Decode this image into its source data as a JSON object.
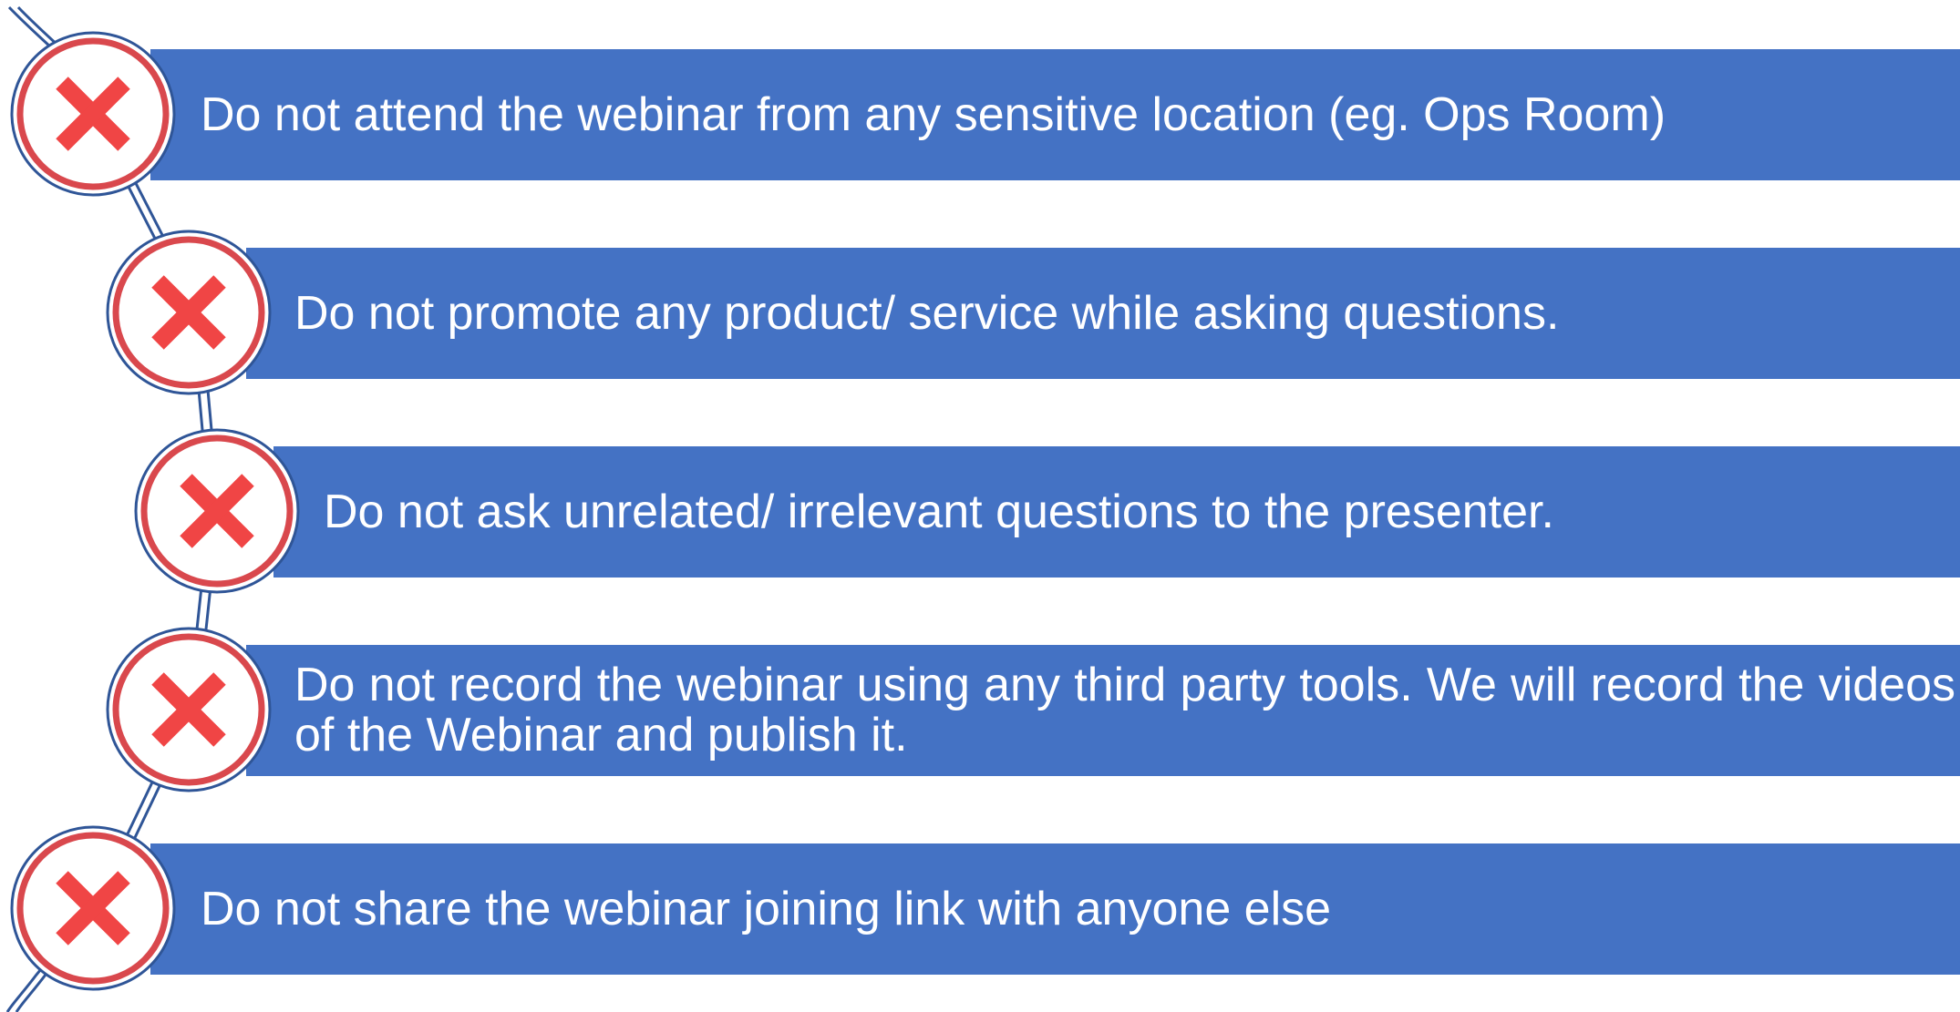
{
  "colors": {
    "bar": "#4472c4",
    "bar_text": "#ffffff",
    "badge_ring": "#d9484d",
    "badge_border": "#2f5597",
    "cross": "#f04545",
    "connector": "#2f5597"
  },
  "rules": [
    {
      "icon": "cross-icon",
      "text": "Do not attend the webinar from any sensitive location (eg. Ops Room)"
    },
    {
      "icon": "cross-icon",
      "text": "Do not promote any product/ service while asking questions."
    },
    {
      "icon": "cross-icon",
      "text": "Do not ask unrelated/ irrelevant questions to the presenter."
    },
    {
      "icon": "cross-icon",
      "text": "Do not record the webinar using any third party tools. We will record the videos of the Webinar and publish it."
    },
    {
      "icon": "cross-icon",
      "text": "Do not share the webinar joining link with anyone else"
    }
  ]
}
